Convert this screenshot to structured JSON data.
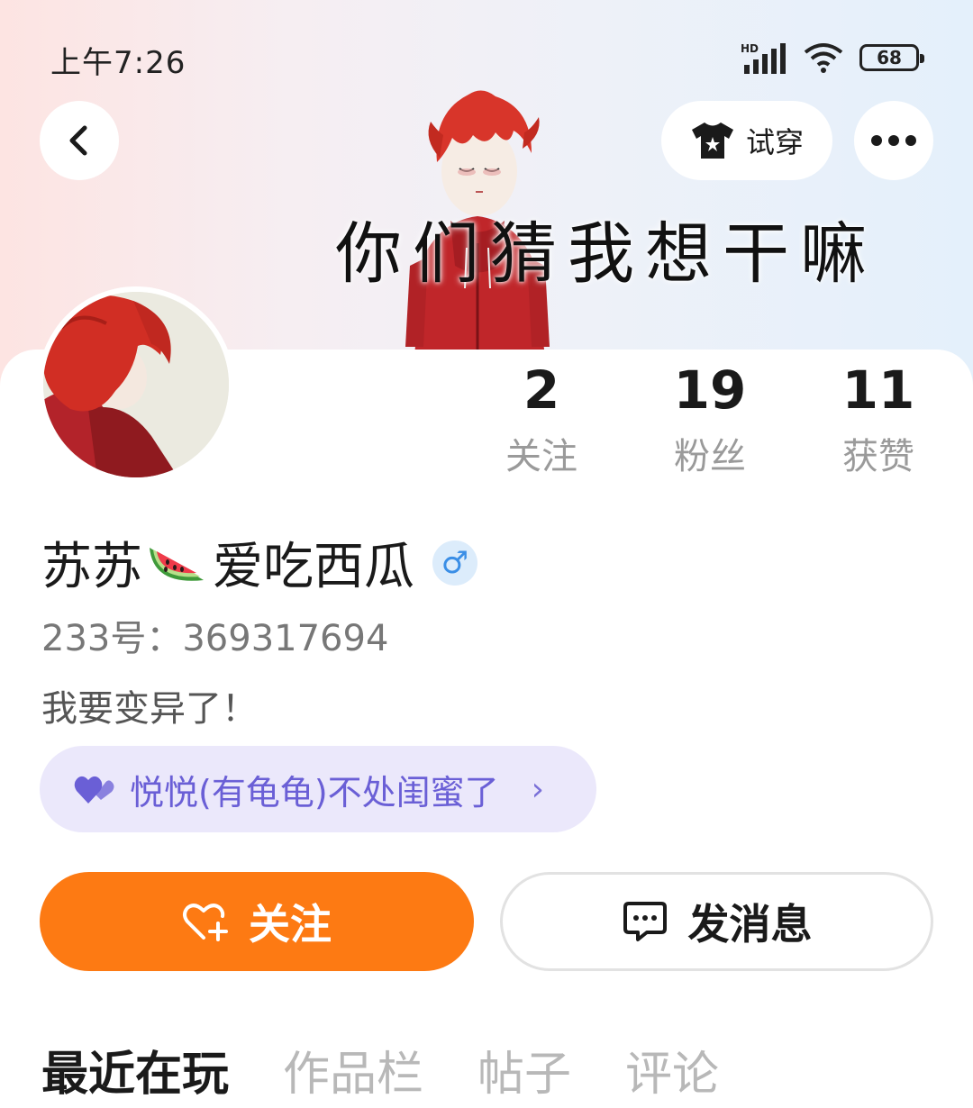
{
  "status_bar": {
    "time": "上午7:26",
    "network_label": "HD",
    "battery": "68",
    "icons": [
      "signal-icon",
      "wifi-icon",
      "battery-icon"
    ]
  },
  "header": {
    "tryon_label": "试穿",
    "banner_text": "你们猜我想干嘛",
    "icons": [
      "back-arrow-icon",
      "tshirt-icon",
      "more-icon"
    ]
  },
  "stats": [
    {
      "value": "2",
      "label": "关注"
    },
    {
      "value": "19",
      "label": "粉丝"
    },
    {
      "value": "11",
      "label": "获赞"
    }
  ],
  "profile": {
    "name_part1": "苏苏",
    "name_part2": "爱吃西瓜",
    "name_emoji": "watermelon-icon",
    "gender": "♂",
    "uid": "233号：369317694",
    "bio": "我要变异了！"
  },
  "relation": {
    "label": "悦悦(有龟龟)不处闺蜜了",
    "icon": "double-heart-icon",
    "chevron": "›"
  },
  "actions": {
    "follow_label": "关注",
    "message_label": "发消息"
  },
  "tabs": [
    "最近在玩",
    "作品栏",
    "帖子",
    "评论"
  ],
  "colors": {
    "accent": "#fd7a13",
    "chip_bg": "#ebe8fb",
    "chip_text": "#6a5fd6",
    "gender": "#3a8ee6"
  }
}
